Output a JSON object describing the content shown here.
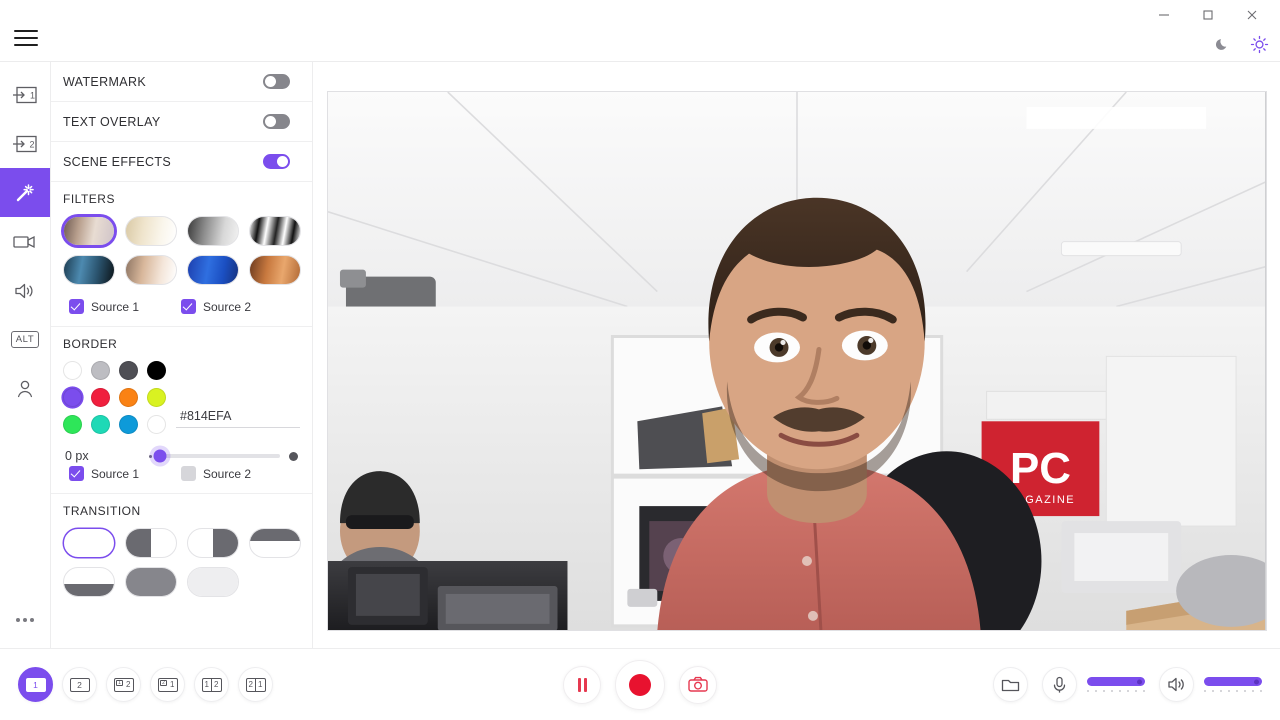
{
  "window": {
    "minimize_label": "—",
    "maximize_label": "▢",
    "close_label": "✕",
    "menu_icon": "hamburger-icon",
    "dark_mode_icon": "moon-icon",
    "light_mode_icon": "sun-icon",
    "accent_color": "#7B4DED"
  },
  "rail": {
    "items": [
      {
        "name": "source-1",
        "icon": "input-1-icon",
        "label": "1",
        "active": false
      },
      {
        "name": "source-2",
        "icon": "input-2-icon",
        "label": "2",
        "active": false
      },
      {
        "name": "effects",
        "icon": "magic-wand-icon",
        "label": "",
        "active": true
      },
      {
        "name": "video",
        "icon": "camera-icon",
        "label": "",
        "active": false
      },
      {
        "name": "audio",
        "icon": "speaker-icon",
        "label": "",
        "active": false
      },
      {
        "name": "alt",
        "icon": "alt-icon",
        "label": "ALT",
        "active": false
      },
      {
        "name": "account",
        "icon": "person-icon",
        "label": "",
        "active": false
      }
    ],
    "more_label": "more-options"
  },
  "panel": {
    "toggles": [
      {
        "label": "WATERMARK",
        "on": false
      },
      {
        "label": "TEXT OVERLAY",
        "on": false
      },
      {
        "label": "SCENE EFFECTS",
        "on": true
      }
    ],
    "filters": {
      "title": "FILTERS",
      "items": [
        {
          "name": "filter-normal",
          "selected": true,
          "css": "linear-gradient(100deg,#6e5a52 0%,#b9a08e 30%,#e8dcd2 60%,#cfc3c8 100%)"
        },
        {
          "name": "filter-sepia",
          "selected": false,
          "css": "linear-gradient(100deg,#d9c9a5 0%,#efe4cc 35%,#faf6ec 70%,#ffffff 100%)"
        },
        {
          "name": "filter-grayscale",
          "selected": false,
          "css": "linear-gradient(100deg,#3a3a3a 0%,#8e8e8e 35%,#d8d8d8 70%,#f2f2f2 100%)"
        },
        {
          "name": "filter-threshold",
          "selected": false,
          "css": "linear-gradient(100deg,#ffffff 0%,#111111 18%,#ffffff 34%,#222222 52%,#ffffff 68%,#111111 84%,#ffffff 100%)"
        },
        {
          "name": "filter-cool",
          "selected": false,
          "css": "linear-gradient(100deg,#1c3b50 0%,#4d8ab0 35%,#2b5570 65%,#0c1418 100%)"
        },
        {
          "name": "filter-bright",
          "selected": false,
          "css": "linear-gradient(100deg,#8d7563 0%,#d8b79b 35%,#f4e6da 70%,#ffffff 100%)"
        },
        {
          "name": "filter-blue",
          "selected": false,
          "css": "linear-gradient(100deg,#1d3fae 0%,#2f6fe0 40%,#1b4fc2 70%,#16327e 100%)"
        },
        {
          "name": "filter-warm",
          "selected": false,
          "css": "linear-gradient(100deg,#6b3a1f 0%,#c8793f 35%,#e9a76d 65%,#b26a36 100%)"
        }
      ],
      "sources": [
        {
          "label": "Source 1",
          "checked": true
        },
        {
          "label": "Source 2",
          "checked": true
        }
      ]
    },
    "border": {
      "title": "BORDER",
      "swatches": [
        {
          "color": "#ffffff",
          "selected": false
        },
        {
          "color": "#bdbdc2",
          "selected": false
        },
        {
          "color": "#4f4f55",
          "selected": false
        },
        {
          "color": "#000000",
          "selected": false
        },
        {
          "color": "#7B4DED",
          "selected": true
        },
        {
          "color": "#f01f3e",
          "selected": false
        },
        {
          "color": "#fa8214",
          "selected": false
        },
        {
          "color": "#d9f221",
          "selected": false
        },
        {
          "color": "#2ee659",
          "selected": false
        },
        {
          "color": "#1ed9b6",
          "selected": false
        },
        {
          "color": "#0e9ad9",
          "selected": false
        },
        {
          "color": "#ffffff",
          "selected": false
        }
      ],
      "hex_value": "#814EFA",
      "hex_placeholder": "#814EFA",
      "thickness_label": "0 px",
      "thickness_percent": 2,
      "sources": [
        {
          "label": "Source 1",
          "checked": true
        },
        {
          "label": "Source 2",
          "checked": false
        }
      ]
    },
    "transition": {
      "title": "TRANSITION",
      "items": [
        {
          "name": "transition-none",
          "selected": true,
          "style": "none"
        },
        {
          "name": "transition-wipe-left",
          "selected": false,
          "style": "left-half"
        },
        {
          "name": "transition-wipe-right",
          "selected": false,
          "style": "right-half"
        },
        {
          "name": "transition-wipe-up",
          "selected": false,
          "style": "top-half"
        },
        {
          "name": "transition-wipe-down",
          "selected": false,
          "style": "bottom-half"
        },
        {
          "name": "transition-fill",
          "selected": false,
          "style": "full-gray"
        },
        {
          "name": "transition-fade",
          "selected": false,
          "style": "light"
        }
      ]
    }
  },
  "preview": {
    "name": "video-preview",
    "description": "webcam preview of a man in a salmon button-up shirt seated in a bright office with white shelving and a red PC MAGAZINE poster",
    "poster_text": "PC",
    "poster_subtext": "MAGAZINE"
  },
  "bottombar": {
    "layouts": [
      {
        "name": "layout-single-1",
        "kind": "single",
        "labels": [
          "1"
        ],
        "active": true
      },
      {
        "name": "layout-single-2",
        "kind": "single",
        "labels": [
          "2"
        ],
        "active": false
      },
      {
        "name": "layout-pip-1-2",
        "kind": "pip",
        "labels": [
          "1",
          "2"
        ],
        "active": false
      },
      {
        "name": "layout-pip-2-1",
        "kind": "pip",
        "labels": [
          "2",
          "1"
        ],
        "active": false
      },
      {
        "name": "layout-split-1-2",
        "kind": "split",
        "labels": [
          "1",
          "2"
        ],
        "active": false
      },
      {
        "name": "layout-split-2-1",
        "kind": "split",
        "labels": [
          "2",
          "1"
        ],
        "active": false
      }
    ],
    "transport": [
      {
        "name": "pause-button",
        "icon": "pause-icon"
      },
      {
        "name": "record-button",
        "icon": "record-icon"
      },
      {
        "name": "snapshot-button",
        "icon": "camera-snapshot-icon"
      }
    ],
    "right": {
      "folder": {
        "name": "open-folder-button",
        "icon": "folder-icon"
      },
      "mic": {
        "name": "microphone-button",
        "icon": "microphone-icon",
        "level_percent": 92
      },
      "speaker": {
        "name": "speaker-button",
        "icon": "speaker-volume-icon",
        "level_percent": 92
      }
    }
  }
}
